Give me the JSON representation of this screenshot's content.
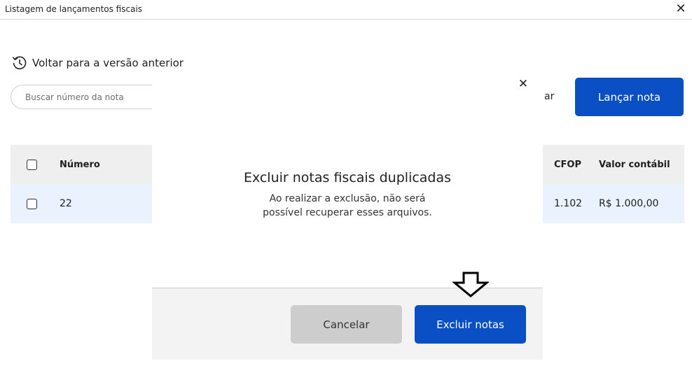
{
  "window": {
    "title": "Listagem de lançamentos fiscais",
    "close_glyph": "✕"
  },
  "back_link": {
    "label": "Voltar para a versão anterior",
    "icon": "history-icon"
  },
  "search": {
    "placeholder": "Buscar número da nota",
    "value": ""
  },
  "partial_button_text": "ar",
  "launch_button": {
    "label": "Lançar nota"
  },
  "table": {
    "headers": {
      "numero": "Número",
      "cfop": "CFOP",
      "valor": "Valor contábil"
    },
    "rows": [
      {
        "numero": "22",
        "cfop": "1.102",
        "valor": "R$ 1.000,00"
      }
    ]
  },
  "modal": {
    "close_glyph": "✕",
    "title": "Excluir notas fiscais duplicadas",
    "description": "Ao realizar a exclusão, não será possível recuperar esses arquivos.",
    "cancel_label": "Cancelar",
    "confirm_label": "Excluir notas"
  },
  "colors": {
    "primary": "#0a4fc4",
    "row_highlight": "#eaf2fd",
    "header_bg": "#efefef",
    "cancel_bg": "#cdcdcd"
  },
  "annotation": {
    "icon": "down-arrow-icon"
  }
}
